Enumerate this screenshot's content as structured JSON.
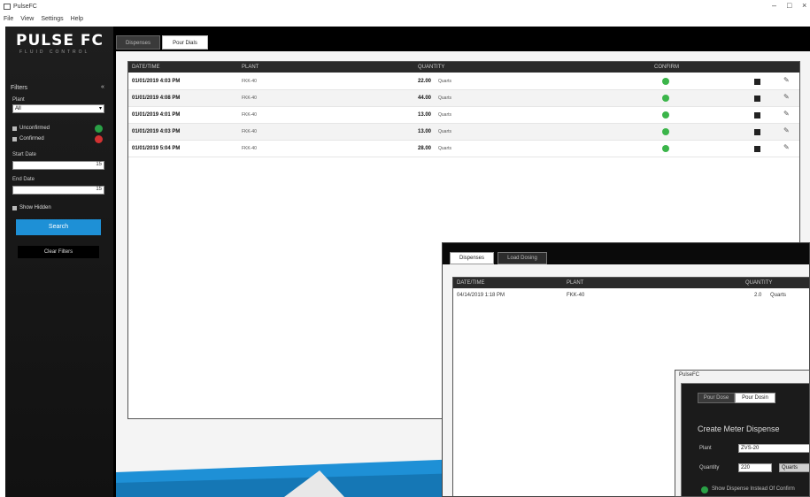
{
  "window": {
    "title": "PulseFC",
    "min": "–",
    "max": "□",
    "close": "×"
  },
  "menu": [
    "File",
    "View",
    "Settings",
    "Help"
  ],
  "brand": {
    "logo": "PULSE FC",
    "tagline": "FLUID CONTROL"
  },
  "sidebar": {
    "heading": "Filters",
    "collapse": "«",
    "plant_label": "Plant",
    "plant_value": "All",
    "checks": [
      "Unconfirmed",
      "Confirmed"
    ],
    "start_label": "Start Date",
    "end_label": "End Date",
    "show_hidden": "Show Hidden",
    "search_button": "Search",
    "clear_button": "Clear Filters",
    "calendar": "15"
  },
  "tabs": [
    "Dispenses",
    "Pour Dials"
  ],
  "table": {
    "headers": [
      "DATE/TIME",
      "PLANT",
      "QUANTITY",
      "CONFIRM"
    ],
    "rows": [
      {
        "date": "01/01/2019 4:03 PM",
        "plant": "FKK-40",
        "qty": "22.00",
        "unit": "Quarts"
      },
      {
        "date": "01/01/2019 4:08 PM",
        "plant": "FKK-40",
        "qty": "44.00",
        "unit": "Quarts"
      },
      {
        "date": "01/01/2019 4:01 PM",
        "plant": "FKK-40",
        "qty": "13.00",
        "unit": "Quarts"
      },
      {
        "date": "01/01/2019 4:03 PM",
        "plant": "FKK-40",
        "qty": "13.00",
        "unit": "Quarts"
      },
      {
        "date": "01/01/2019 5:04 PM",
        "plant": "FKK-40",
        "qty": "28.00",
        "unit": "Quarts"
      }
    ]
  },
  "colors": {
    "accent": "#1e90d6",
    "confirmed": "#3bb54a",
    "unconfirmed": "#d23232"
  },
  "overlay_dispenses": {
    "tabs": [
      "Dispenses",
      "Load Dosing"
    ],
    "headers": [
      "DATE/TIME",
      "PLANT",
      "QUANTITY"
    ],
    "row": {
      "date": "04/14/2019 1:18 PM",
      "plant": "FKK-40",
      "qty": "2.0",
      "unit": "Quarts"
    }
  },
  "overlay_dialog": {
    "title": "PulseFC",
    "tabs": [
      "Pour Dose",
      "Pour Dosin"
    ],
    "heading": "Create Meter Dispense",
    "plant_label": "Plant",
    "plant_value": "ZVS-20",
    "qty_label": "Quantity",
    "qty_value": "220",
    "unit_value": "Quarts",
    "option": "Show Dispense Instead Of Confirm"
  }
}
